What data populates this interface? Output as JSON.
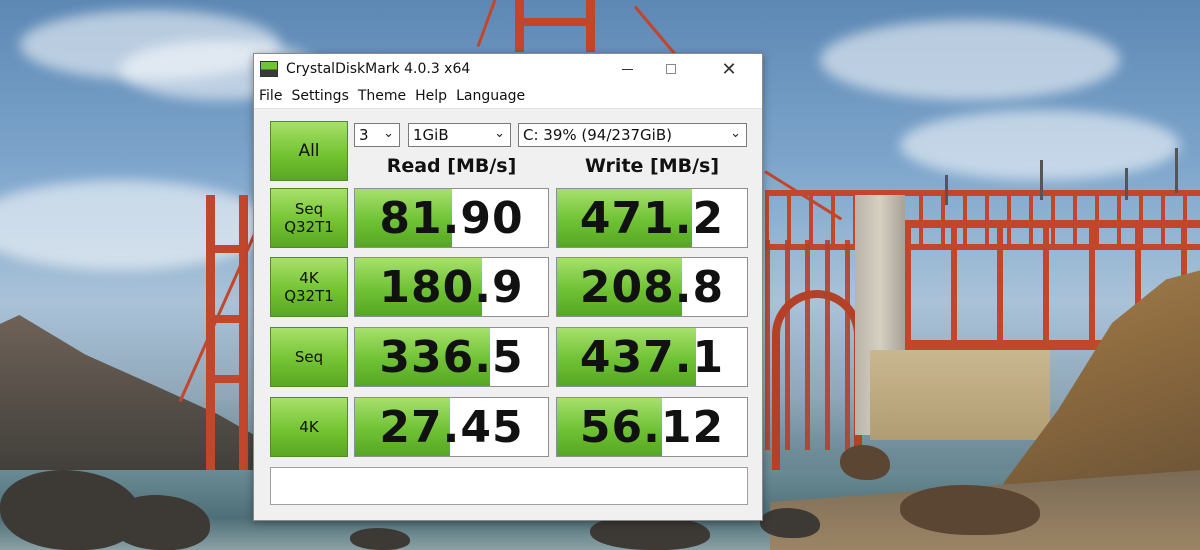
{
  "window": {
    "title": "CrystalDiskMark 4.0.3 x64",
    "close_glyph": "✕"
  },
  "menu": [
    "File",
    "Settings",
    "Theme",
    "Help",
    "Language"
  ],
  "controls": {
    "all_label": "All",
    "test_count": "3",
    "test_size": "1GiB",
    "drive": "C: 39% (94/237GiB)",
    "dropdown_glyph": "⌄"
  },
  "headers": {
    "read": "Read [MB/s]",
    "write": "Write [MB/s]"
  },
  "rows": [
    {
      "label": "Seq\nQ32T1",
      "read": "81.90",
      "write": "471.2",
      "read_fill_pct": 50,
      "write_fill_pct": 71
    },
    {
      "label": "4K\nQ32T1",
      "read": "180.9",
      "write": "208.8",
      "read_fill_pct": 66,
      "write_fill_pct": 66
    },
    {
      "label": "Seq",
      "read": "336.5",
      "write": "437.1",
      "read_fill_pct": 70,
      "write_fill_pct": 73
    },
    {
      "label": "4K",
      "read": "27.45",
      "write": "56.12",
      "read_fill_pct": 49,
      "write_fill_pct": 55
    }
  ],
  "status_text": "",
  "colors": {
    "accent_green": "#74c433",
    "bridge_red": "#c2462c"
  },
  "icons": [
    "crystaldiskmark-app-icon",
    "minimize-icon",
    "maximize-icon",
    "close-icon",
    "chevron-down-icon"
  ]
}
